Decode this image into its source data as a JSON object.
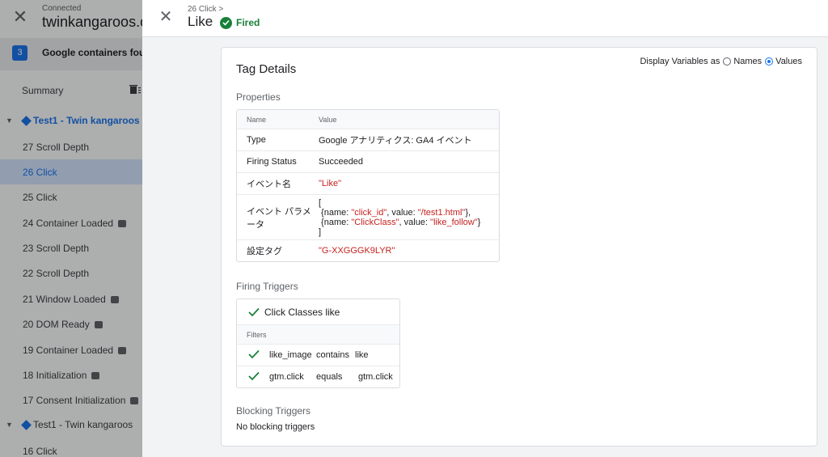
{
  "left_panel": {
    "connected_label": "Connected",
    "domain": "twinkangaroos.co",
    "banner_count": "3",
    "banner_text": "Google containers foun",
    "summary_label": "Summary",
    "groups": [
      {
        "label": "Test1 - Twin kangaroos",
        "items": [
          {
            "label": "27 Scroll Depth",
            "active": false,
            "tag": false
          },
          {
            "label": "26 Click",
            "active": true,
            "tag": false
          },
          {
            "label": "25 Click",
            "active": false,
            "tag": false
          },
          {
            "label": "24 Container Loaded",
            "active": false,
            "tag": true
          },
          {
            "label": "23 Scroll Depth",
            "active": false,
            "tag": false
          },
          {
            "label": "22 Scroll Depth",
            "active": false,
            "tag": false
          },
          {
            "label": "21 Window Loaded",
            "active": false,
            "tag": true
          },
          {
            "label": "20 DOM Ready",
            "active": false,
            "tag": true
          },
          {
            "label": "19 Container Loaded",
            "active": false,
            "tag": true
          },
          {
            "label": "18 Initialization",
            "active": false,
            "tag": true
          },
          {
            "label": "17 Consent Initialization",
            "active": false,
            "tag": true
          }
        ]
      },
      {
        "label": "Test1 - Twin kangaroos",
        "items": [
          {
            "label": "16 Click",
            "active": false,
            "tag": false
          }
        ]
      }
    ]
  },
  "header": {
    "breadcrumb": "26 Click >",
    "title": "Like",
    "status": "Fired"
  },
  "card": {
    "title": "Tag Details",
    "display_vars_label": "Display Variables as",
    "option_names": "Names",
    "option_values": "Values",
    "selected_option": "Values"
  },
  "properties": {
    "section_title": "Properties",
    "col_name": "Name",
    "col_value": "Value",
    "type_name": "Type",
    "type_value": "Google アナリティクス: GA4 イベント",
    "firing_name": "Firing Status",
    "firing_value": "Succeeded",
    "event_name_label": "イベント名",
    "event_name_value": "\"Like\"",
    "params_label": "イベント パラメータ",
    "params": [
      {
        "key": "\"click_id\"",
        "value": "\"/test1.html\"",
        "suffix": "},"
      },
      {
        "key": "\"ClickClass\"",
        "value": "\"like_follow\"",
        "suffix": "}"
      }
    ],
    "config_tag_label": "設定タグ",
    "config_tag_value": "\"G-XXGGGK9LYR\""
  },
  "firing_triggers": {
    "section_title": "Firing Triggers",
    "trigger_name": "Click Classes like",
    "filters_label": "Filters",
    "filters": [
      {
        "var": "like_image",
        "op": "contains",
        "val": "like"
      },
      {
        "var": "gtm.click",
        "op": "equals",
        "val": "gtm.click"
      }
    ]
  },
  "blocking_triggers": {
    "section_title": "Blocking Triggers",
    "text": "No blocking triggers"
  },
  "colors": {
    "accent": "#1a73e8",
    "success": "#188038",
    "string_value": "#c5221f"
  }
}
